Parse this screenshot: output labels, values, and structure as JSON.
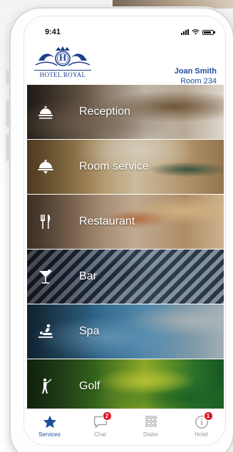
{
  "status_bar": {
    "time": "9:41"
  },
  "brand": {
    "logo_text": "HOTEL ROYAL",
    "monogram": "H"
  },
  "guest": {
    "name": "Joan Smith",
    "room": "Room 234"
  },
  "services": [
    {
      "label": "Reception",
      "icon": "reception-bell-icon"
    },
    {
      "label": "Room service",
      "icon": "room-service-cloche-icon"
    },
    {
      "label": "Restaurant",
      "icon": "fork-knife-icon"
    },
    {
      "label": "Bar",
      "icon": "cocktail-glass-icon"
    },
    {
      "label": "Spa",
      "icon": "massage-icon"
    },
    {
      "label": "Golf",
      "icon": "golfer-icon"
    }
  ],
  "tabs": [
    {
      "label": "Services",
      "icon": "star-icon",
      "active": true
    },
    {
      "label": "Chat",
      "icon": "chat-bubble-icon",
      "badge": "2"
    },
    {
      "label": "Dialer",
      "icon": "dialpad-icon"
    },
    {
      "label": "Hotel",
      "icon": "info-icon",
      "badge": "1"
    }
  ],
  "colors": {
    "accent": "#1f4e9c",
    "badge": "#e0162b"
  }
}
